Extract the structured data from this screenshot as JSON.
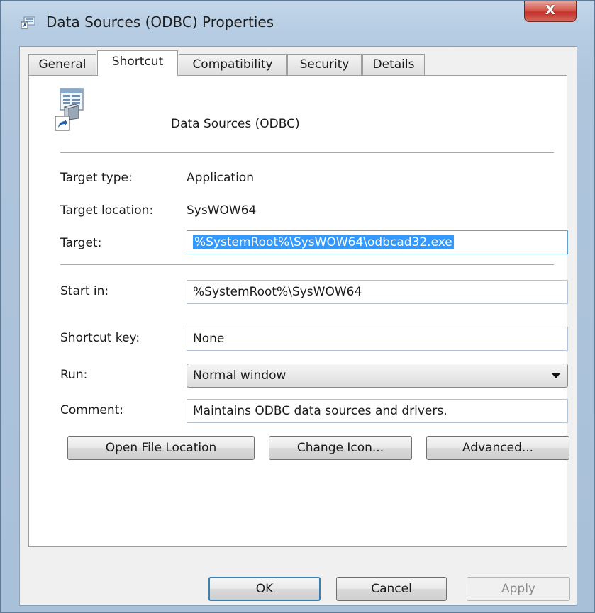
{
  "window": {
    "title": "Data Sources (ODBC) Properties",
    "close_label": "X"
  },
  "tabs": [
    {
      "label": "General"
    },
    {
      "label": "Shortcut"
    },
    {
      "label": "Compatibility"
    },
    {
      "label": "Security"
    },
    {
      "label": "Details"
    }
  ],
  "active_tab": "Shortcut",
  "shortcut": {
    "name": "Data Sources (ODBC)",
    "target_type_label": "Target type:",
    "target_type_value": "Application",
    "target_location_label": "Target location:",
    "target_location_value": "SysWOW64",
    "target_label": "Target:",
    "target_value": "%SystemRoot%\\SysWOW64\\odbcad32.exe",
    "start_in_label": "Start in:",
    "start_in_value": "%SystemRoot%\\SysWOW64",
    "shortcut_key_label": "Shortcut key:",
    "shortcut_key_value": "None",
    "run_label": "Run:",
    "run_value": "Normal window",
    "comment_label": "Comment:",
    "comment_value": "Maintains ODBC data sources and drivers.",
    "open_file_location_label": "Open File Location",
    "change_icon_label": "Change Icon...",
    "advanced_label": "Advanced..."
  },
  "footer": {
    "ok_label": "OK",
    "cancel_label": "Cancel",
    "apply_label": "Apply"
  },
  "icons": {
    "title": "odbc-icon",
    "app": "odbc-app-icon",
    "shortcut_overlay": "shortcut-arrow-icon"
  }
}
